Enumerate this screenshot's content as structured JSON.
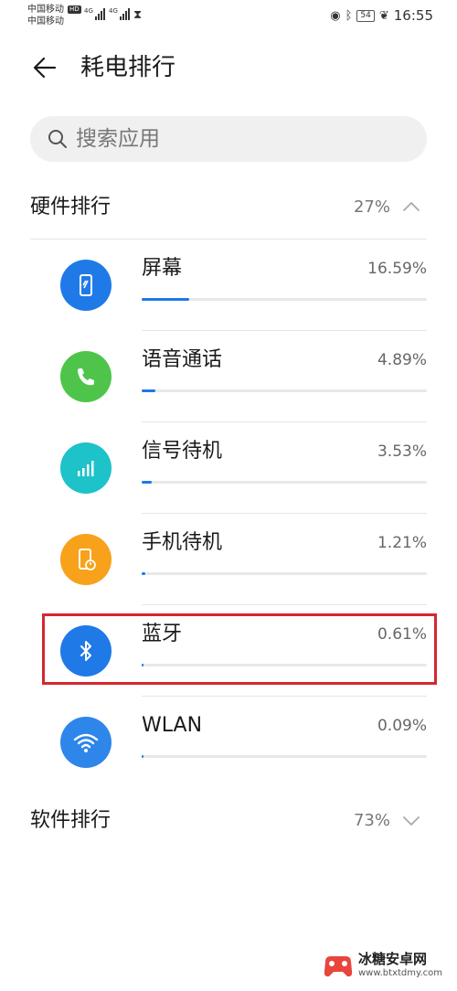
{
  "status_bar": {
    "carrier1": "中国移动",
    "carrier1_badge": "HD",
    "carrier2": "中国移动",
    "signal_label": "4G",
    "battery": "54",
    "time": "16:55"
  },
  "header": {
    "title": "耗电排行"
  },
  "search": {
    "placeholder": "搜索应用"
  },
  "hardware": {
    "title": "硬件排行",
    "percent": "27%",
    "expanded": true,
    "items": [
      {
        "name": "屏幕",
        "percent": "16.59%",
        "fraction": 0.1659,
        "icon": "phone-screen-icon",
        "color": "#1f7ae8"
      },
      {
        "name": "语音通话",
        "percent": "4.89%",
        "fraction": 0.0489,
        "icon": "phone-call-icon",
        "color": "#4ec54a"
      },
      {
        "name": "信号待机",
        "percent": "3.53%",
        "fraction": 0.0353,
        "icon": "signal-bars-icon",
        "color": "#1ec2c9"
      },
      {
        "name": "手机待机",
        "percent": "1.21%",
        "fraction": 0.0121,
        "icon": "phone-standby-icon",
        "color": "#f7a21a"
      },
      {
        "name": "蓝牙",
        "percent": "0.61%",
        "fraction": 0.0061,
        "icon": "bluetooth-icon",
        "color": "#1f7ae8"
      },
      {
        "name": "WLAN",
        "percent": "0.09%",
        "fraction": 0.0009,
        "icon": "wifi-icon",
        "color": "#2f86ea"
      }
    ]
  },
  "software": {
    "title": "软件排行",
    "percent": "73%",
    "expanded": false
  },
  "highlight": {
    "color": "#d6262e",
    "target": "蓝牙"
  },
  "watermark": {
    "name": "冰糖安卓网",
    "url": "www.btxtdmy.com"
  }
}
